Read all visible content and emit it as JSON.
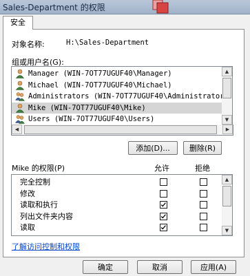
{
  "window": {
    "title": "Sales-Department 的权限"
  },
  "tab": {
    "label": "安全"
  },
  "object": {
    "label": "对象名称:",
    "value": "H:\\Sales-Department"
  },
  "groups": {
    "label": "组或用户名(G):",
    "items": [
      {
        "name": "Manager (WIN-7OT77UGUF40\\Manager)",
        "icon": "user-icon",
        "selected": false
      },
      {
        "name": "Michael (WIN-7OT77UGUF40\\Michael)",
        "icon": "user-icon",
        "selected": false
      },
      {
        "name": "Administrators (WIN-7OT77UGUF40\\Administrators)",
        "icon": "group-icon",
        "selected": false
      },
      {
        "name": "Mike (WIN-7OT77UGUF40\\Mike)",
        "icon": "user-icon",
        "selected": true
      },
      {
        "name": "Users (WIN-7OT77UGUF40\\Users)",
        "icon": "group-icon",
        "selected": false
      }
    ]
  },
  "buttons": {
    "add": "添加(D)...",
    "remove": "删除(R)",
    "ok": "确定",
    "cancel": "取消",
    "apply": "应用(A)"
  },
  "permissions": {
    "label": "Mike 的权限(P)",
    "allow_header": "允许",
    "deny_header": "拒绝",
    "items": [
      {
        "name": "完全控制",
        "allow": false,
        "deny": false
      },
      {
        "name": "修改",
        "allow": false,
        "deny": false
      },
      {
        "name": "读取和执行",
        "allow": true,
        "deny": false
      },
      {
        "name": "列出文件夹内容",
        "allow": true,
        "deny": false
      },
      {
        "name": "读取",
        "allow": true,
        "deny": false
      }
    ]
  },
  "link": {
    "text": "了解访问控制和权限"
  },
  "colors": {
    "link": "#0044cc",
    "selected_row": "#d5d5d5",
    "close_button": "#d64541"
  }
}
